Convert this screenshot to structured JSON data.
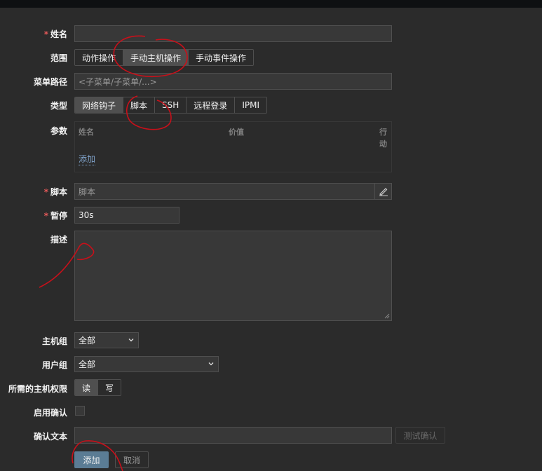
{
  "form": {
    "name_label": "姓名",
    "name_value": "",
    "scope_label": "范围",
    "scope_options": [
      "动作操作",
      "手动主机操作",
      "手动事件操作"
    ],
    "menu_path_label": "菜单路径",
    "menu_path_placeholder": "<子菜单/子菜单/...>",
    "type_label": "类型",
    "type_options": [
      "网络钩子",
      "脚本",
      "SSH",
      "远程登录",
      "IPMI"
    ],
    "params_label": "参数",
    "params_col_name": "姓名",
    "params_col_value": "价值",
    "params_col_action_1": "行",
    "params_col_action_2": "动",
    "params_add_link": "添加",
    "script_label": "脚本",
    "script_placeholder": "脚本",
    "timeout_label": "暂停",
    "timeout_value": "30s",
    "description_label": "描述",
    "description_value": "",
    "host_group_label": "主机组",
    "host_group_value": "全部",
    "user_group_label": "用户组",
    "user_group_value": "全部",
    "host_perm_label": "所需的主机权限",
    "host_perm_options": [
      "读",
      "写"
    ],
    "confirm_enable_label": "启用确认",
    "confirm_text_label": "确认文本",
    "confirm_text_value": "",
    "test_confirm_button": "测试确认",
    "add_button": "添加",
    "cancel_button": "取消"
  },
  "colors": {
    "background": "#2b2b2b",
    "field_bg": "#383838",
    "border": "#4f4f4f",
    "required": "#e45959",
    "link": "#7fa2c9",
    "primary_button": "#5b7c94",
    "annotation": "#c8101a"
  },
  "icons": [
    "pencil-icon",
    "chevron-down-icon"
  ]
}
